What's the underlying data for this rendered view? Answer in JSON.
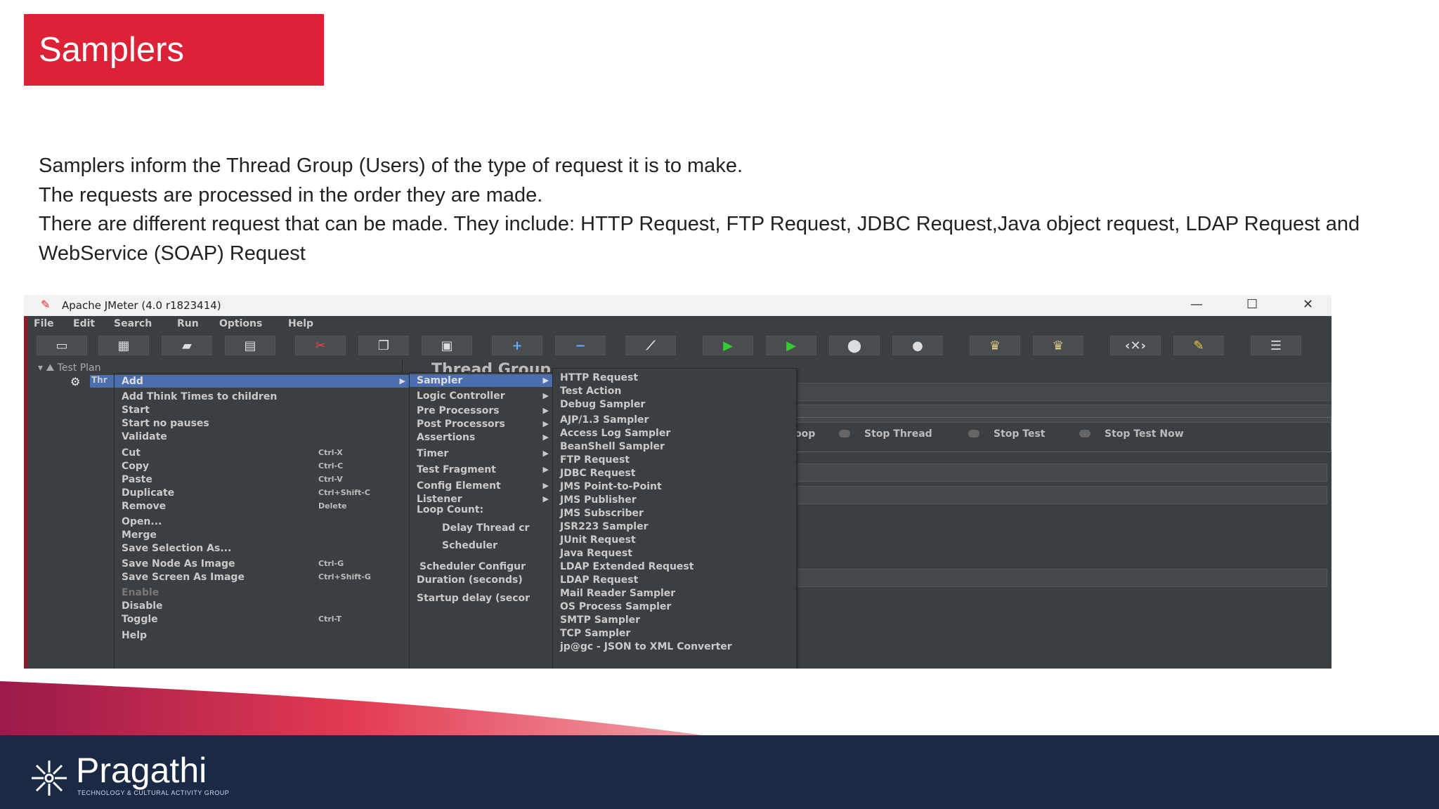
{
  "slide": {
    "title": "Samplers",
    "paragraphs": [
      "Samplers inform the Thread Group (Users) of the type of request it is to make.",
      "The requests are processed in the order they are made.",
      "There are different request that can be made. They include: HTTP Request, FTP Request, JDBC Request,Java object request, LDAP Request and WebService (SOAP) Request"
    ]
  },
  "jmeter": {
    "window_title": "Apache JMeter (4.0 r1823414)",
    "menubar": [
      "File",
      "Edit",
      "Search",
      "Run",
      "Options",
      "Help"
    ],
    "tree": {
      "root": "Test Plan",
      "selected": "Thr"
    },
    "right_panel_title": "Thread Group",
    "thread_options": [
      "oop",
      "Stop Thread",
      "Stop Test",
      "Stop Test Now"
    ],
    "context_menu": [
      {
        "label": "Add",
        "highlight": true,
        "arrow": "▶"
      },
      {
        "label": "Add Think Times to children"
      },
      {
        "label": "Start"
      },
      {
        "label": "Start no pauses"
      },
      {
        "label": "Validate"
      },
      {
        "label": "Cut",
        "shortcut": "Ctrl-X"
      },
      {
        "label": "Copy",
        "shortcut": "Ctrl-C"
      },
      {
        "label": "Paste",
        "shortcut": "Ctrl-V"
      },
      {
        "label": "Duplicate",
        "shortcut": "Ctrl+Shift-C"
      },
      {
        "label": "Remove",
        "shortcut": "Delete"
      },
      {
        "label": "Open..."
      },
      {
        "label": "Merge"
      },
      {
        "label": "Save Selection As..."
      },
      {
        "label": "Save Node As Image",
        "shortcut": "Ctrl-G"
      },
      {
        "label": "Save Screen As Image",
        "shortcut": "Ctrl+Shift-G"
      },
      {
        "label": "Enable",
        "dim": true
      },
      {
        "label": "Disable"
      },
      {
        "label": "Toggle",
        "shortcut": "Ctrl-T"
      },
      {
        "label": "Help"
      }
    ],
    "add_submenu": [
      {
        "label": "Sampler",
        "highlight": true,
        "arrow": "▶"
      },
      {
        "label": "Logic Controller",
        "arrow": "▶"
      },
      {
        "label": "Pre Processors",
        "arrow": "▶"
      },
      {
        "label": "Post Processors",
        "arrow": "▶"
      },
      {
        "label": "Assertions",
        "arrow": "▶"
      },
      {
        "label": "Timer",
        "arrow": "▶"
      },
      {
        "label": "Test Fragment",
        "arrow": "▶"
      },
      {
        "label": "Config Element",
        "arrow": "▶"
      },
      {
        "label": "Listener",
        "arrow": "▶"
      },
      {
        "label": "Loop Count:"
      },
      {
        "label": "Delay Thread cr"
      },
      {
        "label": "Scheduler"
      },
      {
        "label": "Scheduler Configur"
      },
      {
        "label": "Duration (seconds)"
      },
      {
        "label": "Startup delay (secor"
      }
    ],
    "sampler_submenu": [
      "HTTP Request",
      "Test Action",
      "Debug Sampler",
      "AJP/1.3 Sampler",
      "Access Log Sampler",
      "BeanShell Sampler",
      "FTP Request",
      "JDBC Request",
      "JMS Point-to-Point",
      "JMS Publisher",
      "JMS Subscriber",
      "JSR223 Sampler",
      "JUnit Request",
      "Java Request",
      "LDAP Extended Request",
      "LDAP Request",
      "Mail Reader Sampler",
      "OS Process Sampler",
      "SMTP Sampler",
      "TCP Sampler",
      "jp@gc - JSON to XML Converter"
    ]
  },
  "footer": {
    "brand": "Pragathi",
    "tagline": "TECHNOLOGY & CULTURAL ACTIVITY GROUP"
  },
  "colors": {
    "title_bg": "#dd2237",
    "footer_bg": "#1b2a44",
    "menu_highlight": "#4b6eaf"
  }
}
